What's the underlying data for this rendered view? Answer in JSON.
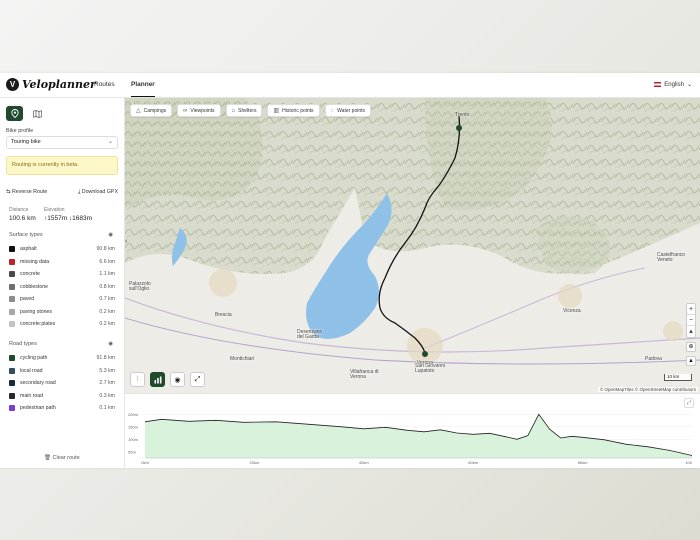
{
  "header": {
    "app_name": "Veloplanner",
    "nav": [
      "Routes",
      "Planner"
    ],
    "language": "English"
  },
  "sidebar": {
    "bike_profile_label": "Bike profile",
    "bike_profile_value": "Touring bike",
    "beta_notice": "Routing is currently in beta.",
    "reverse_label": "Reverse Route",
    "download_label": "Download GPX",
    "distance_label": "Distance",
    "distance_value": "100.6 km",
    "elevation_label": "Elevation",
    "elevation_value": "↑1557m ↓1683m",
    "surface_title": "Surface types",
    "surfaces": [
      {
        "name": "asphalt",
        "value": "90.8 km",
        "color": "#111111"
      },
      {
        "name": "missing data",
        "value": "6.6 km",
        "color": "#c0202a"
      },
      {
        "name": "concrete",
        "value": "1.1 km",
        "color": "#4a4a4a"
      },
      {
        "name": "cobblestone",
        "value": "0.8 km",
        "color": "#6e6e6e"
      },
      {
        "name": "paved",
        "value": "0.7 km",
        "color": "#8c8c8c"
      },
      {
        "name": "paving stones",
        "value": "0.2 km",
        "color": "#a8a8a8"
      },
      {
        "name": "concrete:plates",
        "value": "0.2 km",
        "color": "#c4c4c4"
      }
    ],
    "road_title": "Road types",
    "roads": [
      {
        "name": "cycling path",
        "value": "91.8 km",
        "color": "#1f4a2d"
      },
      {
        "name": "local road",
        "value": "5.3 km",
        "color": "#2f4f5f"
      },
      {
        "name": "secondary road",
        "value": "2.7 km",
        "color": "#1a2a3a"
      },
      {
        "name": "main road",
        "value": "0.3 km",
        "color": "#2a2a2a"
      },
      {
        "name": "pedestrian path",
        "value": "0.1 km",
        "color": "#7a3fc8"
      }
    ],
    "clear_label": "Clear route"
  },
  "map": {
    "poi_buttons": [
      {
        "label": "Campings",
        "icon": "tent-icon"
      },
      {
        "label": "Viewpoints",
        "icon": "binoculars-icon"
      },
      {
        "label": "Shelters",
        "icon": "shelter-icon"
      },
      {
        "label": "Historic points",
        "icon": "monument-icon"
      },
      {
        "label": "Water points",
        "icon": "droplet-icon"
      }
    ],
    "cities": [
      "Trento",
      "Brescia",
      "Verona",
      "Vicenza",
      "Padova",
      "Montichiari",
      "Desenzano del Garda",
      "Villafranca di Verona",
      "San Giovanni Lupatoto",
      "Castelfranco Veneto",
      "Palazzolo sull'Oglio"
    ],
    "scale_label": "10 km",
    "attribution": "© OpenMapTiles © OpenStreetMap contributors"
  },
  "elevation_chart": {
    "y_ticks": [
      "200m",
      "150m",
      "100m",
      "50m"
    ],
    "x_ticks": [
      "0km",
      "20km",
      "40km",
      "60km",
      "80km",
      "100"
    ],
    "x_values": [
      0,
      3,
      8,
      13,
      18,
      24,
      30,
      36,
      40,
      44,
      48,
      51,
      54,
      57,
      60,
      63,
      66,
      68,
      70,
      72,
      74,
      76,
      78,
      80,
      84,
      88,
      92,
      96,
      100
    ],
    "y_values": [
      170,
      180,
      172,
      176,
      168,
      170,
      160,
      150,
      142,
      148,
      136,
      130,
      138,
      125,
      120,
      124,
      110,
      100,
      115,
      200,
      140,
      105,
      112,
      108,
      98,
      80,
      70,
      55,
      35
    ]
  }
}
